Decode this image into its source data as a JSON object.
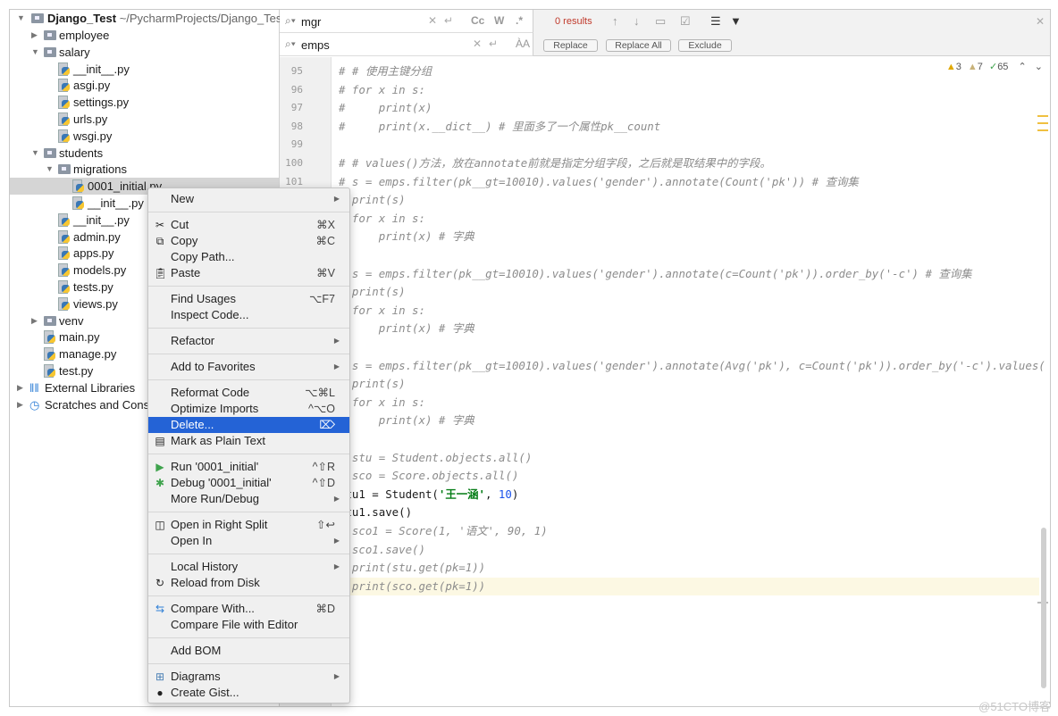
{
  "project": {
    "root": "Django_Test",
    "root_path": "~/PycharmProjects/Django_Test",
    "tree": [
      {
        "label": "employee",
        "level": 1,
        "type": "folder",
        "arrow": "right"
      },
      {
        "label": "salary",
        "level": 1,
        "type": "folder",
        "arrow": "down"
      },
      {
        "label": "__init__.py",
        "level": 2,
        "type": "py"
      },
      {
        "label": "asgi.py",
        "level": 2,
        "type": "py"
      },
      {
        "label": "settings.py",
        "level": 2,
        "type": "py"
      },
      {
        "label": "urls.py",
        "level": 2,
        "type": "py"
      },
      {
        "label": "wsgi.py",
        "level": 2,
        "type": "py"
      },
      {
        "label": "students",
        "level": 1,
        "type": "folder",
        "arrow": "down"
      },
      {
        "label": "migrations",
        "level": 2,
        "type": "folder",
        "arrow": "down"
      },
      {
        "label": "0001_initial.py",
        "level": 3,
        "type": "py",
        "selected": true
      },
      {
        "label": "__init__.py",
        "level": 3,
        "type": "py"
      },
      {
        "label": "__init__.py",
        "level": 2,
        "type": "py"
      },
      {
        "label": "admin.py",
        "level": 2,
        "type": "py"
      },
      {
        "label": "apps.py",
        "level": 2,
        "type": "py"
      },
      {
        "label": "models.py",
        "level": 2,
        "type": "py"
      },
      {
        "label": "tests.py",
        "level": 2,
        "type": "py"
      },
      {
        "label": "views.py",
        "level": 2,
        "type": "py"
      },
      {
        "label": "venv",
        "level": 1,
        "type": "folder",
        "arrow": "right"
      },
      {
        "label": "main.py",
        "level": 1,
        "type": "py"
      },
      {
        "label": "manage.py",
        "level": 1,
        "type": "py"
      },
      {
        "label": "test.py",
        "level": 1,
        "type": "py"
      },
      {
        "label": "External Libraries",
        "level": 0,
        "type": "lib",
        "arrow": "right"
      },
      {
        "label": "Scratches and Consoles",
        "level": 0,
        "type": "scratch",
        "arrow": "right"
      }
    ]
  },
  "search": {
    "find_value": "mgr",
    "replace_value": "emps",
    "results": "0 results",
    "opts": [
      "Cc",
      "W",
      ".*"
    ],
    "replace": "Replace",
    "replace_all": "Replace All",
    "exclude": "Exclude"
  },
  "inspections": {
    "warnings": "3",
    "weak_warnings": "7",
    "typos": "65"
  },
  "editor": {
    "lines": [
      {
        "n": "95",
        "segs": [
          [
            "cm",
            "# # 使用主键分组"
          ]
        ]
      },
      {
        "n": "96",
        "segs": [
          [
            "cm",
            "# for x in s:"
          ]
        ]
      },
      {
        "n": "97",
        "segs": [
          [
            "cm",
            "#     print(x)"
          ]
        ]
      },
      {
        "n": "98",
        "segs": [
          [
            "cm",
            "#     print(x.__dict__) # 里面多了一个属性pk__count"
          ]
        ]
      },
      {
        "n": "99",
        "segs": []
      },
      {
        "n": "100",
        "segs": [
          [
            "cm",
            "# # values()方法，放在annotate前就是指定分组字段，之后就是取结果中的字段。"
          ]
        ]
      },
      {
        "n": "101",
        "segs": [
          [
            "cm",
            "# s = emps.filter(pk__gt=10010).values('gender').annotate(Count('pk')) # 查询集"
          ]
        ]
      },
      {
        "n": "102",
        "segs": [
          [
            "cm",
            "# print(s)"
          ]
        ]
      },
      {
        "n": "103",
        "segs": [
          [
            "cm",
            "# for x in s:"
          ]
        ]
      },
      {
        "n": "104",
        "segs": [
          [
            "cm",
            "#     print(x) # 字典"
          ]
        ]
      },
      {
        "n": "105",
        "segs": []
      },
      {
        "n": "106",
        "segs": [
          [
            "cm",
            "# s = emps.filter(pk__gt=10010).values('gender').annotate(c=Count('pk')).order_by('-c') # 查询集"
          ]
        ]
      },
      {
        "n": "107",
        "segs": [
          [
            "cm",
            "# print(s)"
          ]
        ]
      },
      {
        "n": "108",
        "segs": [
          [
            "cm",
            "# for x in s:"
          ]
        ]
      },
      {
        "n": "109",
        "segs": [
          [
            "cm",
            "#     print(x) # 字典"
          ]
        ]
      },
      {
        "n": "110",
        "segs": []
      },
      {
        "n": "111",
        "segs": [
          [
            "cm",
            "# s = emps.filter(pk__gt=10010).values('gender').annotate(Avg('pk'), c=Count('pk')).order_by('-c').values("
          ]
        ]
      },
      {
        "n": "112",
        "segs": [
          [
            "cm",
            "# print(s)"
          ]
        ]
      },
      {
        "n": "113",
        "segs": [
          [
            "cm",
            "# for x in s:"
          ]
        ]
      },
      {
        "n": "114",
        "segs": [
          [
            "cm",
            "#     print(x) # 字典"
          ]
        ]
      },
      {
        "n": "115",
        "segs": []
      },
      {
        "n": "116",
        "segs": [
          [
            "cm",
            "# stu = Student.objects.all()"
          ]
        ]
      },
      {
        "n": "117",
        "segs": [
          [
            "cm",
            "# sco = Score.objects.all()"
          ]
        ]
      },
      {
        "n": "118",
        "segs": [
          [
            "",
            "stu1 = Student("
          ],
          [
            "st",
            "'王一涵'"
          ],
          [
            "",
            ", "
          ],
          [
            "nu",
            "10"
          ],
          [
            "",
            ")"
          ]
        ]
      },
      {
        "n": "119",
        "segs": [
          [
            "",
            "stu1.save()"
          ]
        ]
      },
      {
        "n": "120",
        "segs": [
          [
            "cm",
            "# sco1 = Score(1, '语文', 90, 1)"
          ]
        ]
      },
      {
        "n": "121",
        "segs": [
          [
            "cm",
            "# sco1.save()"
          ]
        ]
      },
      {
        "n": "122",
        "segs": [
          [
            "cm",
            "# print(stu.get(pk=1))"
          ]
        ]
      },
      {
        "n": "123",
        "segs": [
          [
            "cm",
            "# print(sco.get(pk=1))"
          ]
        ],
        "hl": true
      }
    ]
  },
  "context_menu": [
    [
      {
        "label": "New",
        "sub": true
      }
    ],
    [
      {
        "label": "Cut",
        "icon": "✂",
        "sc": "⌘X"
      },
      {
        "label": "Copy",
        "icon": "⧉",
        "sc": "⌘C"
      },
      {
        "label": "Copy Path..."
      },
      {
        "label": "Paste",
        "icon": "📋︎",
        "sc": "⌘V"
      }
    ],
    [
      {
        "label": "Find Usages",
        "sc": "⌥F7"
      },
      {
        "label": "Inspect Code..."
      }
    ],
    [
      {
        "label": "Refactor",
        "sub": true
      }
    ],
    [
      {
        "label": "Add to Favorites",
        "sub": true
      }
    ],
    [
      {
        "label": "Reformat Code",
        "sc": "⌥⌘L"
      },
      {
        "label": "Optimize Imports",
        "sc": "^⌥O"
      },
      {
        "label": "Delete...",
        "sc": "⌦",
        "active": true
      },
      {
        "label": "Mark as Plain Text",
        "icon": "▤"
      }
    ],
    [
      {
        "label": "Run '0001_initial'",
        "icon": "▶",
        "iconColor": "#3fa34d",
        "sc": "^⇧R"
      },
      {
        "label": "Debug '0001_initial'",
        "icon": "✱",
        "iconColor": "#3fa34d",
        "sc": "^⇧D"
      },
      {
        "label": "More Run/Debug",
        "sub": true
      }
    ],
    [
      {
        "label": "Open in Right Split",
        "icon": "◫",
        "sc": "⇧↩"
      },
      {
        "label": "Open In",
        "sub": true
      }
    ],
    [
      {
        "label": "Local History",
        "sub": true
      },
      {
        "label": "Reload from Disk",
        "icon": "↻"
      }
    ],
    [
      {
        "label": "Compare With...",
        "icon": "⇆",
        "iconColor": "#2f7fd6",
        "sc": "⌘D"
      },
      {
        "label": "Compare File with Editor"
      }
    ],
    [
      {
        "label": "Add BOM"
      }
    ],
    [
      {
        "label": "Diagrams",
        "icon": "⊞",
        "iconColor": "#4a7fb5",
        "sub": true
      },
      {
        "label": "Create Gist...",
        "icon": "●"
      }
    ]
  ],
  "watermark": "@51CTO博客"
}
